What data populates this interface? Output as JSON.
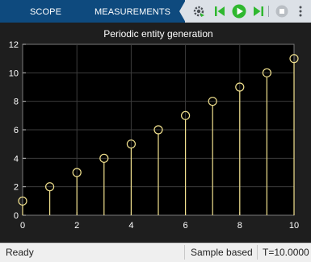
{
  "toolstrip": {
    "tabs": [
      {
        "label": "SCOPE"
      },
      {
        "label": "MEASUREMENTS"
      }
    ]
  },
  "quick_access": {
    "icons": [
      "settings-icon",
      "step-back-icon",
      "run-icon",
      "step-forward-icon",
      "stop-icon",
      "more-options-icon"
    ]
  },
  "colors": {
    "tab_bar": "#0e4a7e",
    "plot_background": "#000000",
    "figure_background": "#1e1e1e",
    "stem_color": "#f2e28f",
    "grid_color": "#3c3c3c",
    "run_green": "#2fb82f"
  },
  "chart_data": {
    "type": "scatter",
    "style": "stem",
    "title": "Periodic entity generation",
    "xlabel": "",
    "ylabel": "",
    "x": [
      0,
      1,
      2,
      3,
      4,
      5,
      6,
      7,
      8,
      9,
      10
    ],
    "y": [
      1,
      2,
      3,
      4,
      5,
      6,
      7,
      8,
      9,
      10,
      11
    ],
    "xlim": [
      0,
      10
    ],
    "ylim": [
      0,
      12
    ],
    "xticks": [
      0,
      2,
      4,
      6,
      8,
      10
    ],
    "yticks": [
      0,
      2,
      4,
      6,
      8,
      10,
      12
    ],
    "grid": true,
    "legend": "none"
  },
  "status_bar": {
    "state": "Ready",
    "mode": "Sample based",
    "time": "T=10.0000"
  }
}
